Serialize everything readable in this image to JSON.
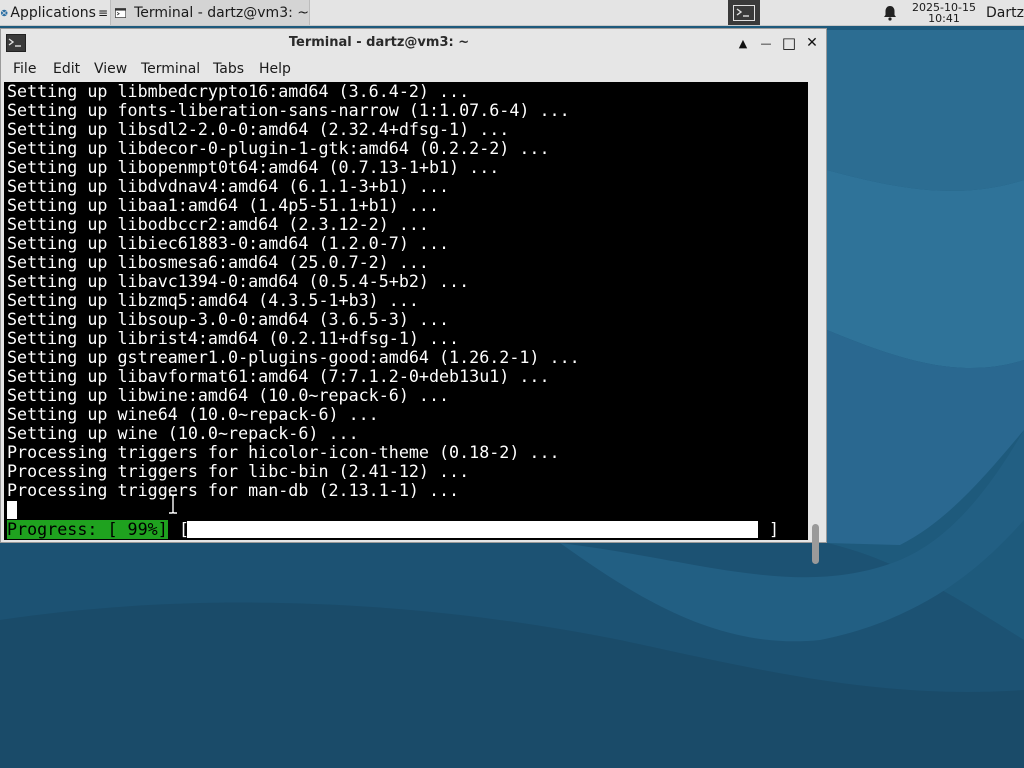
{
  "panel": {
    "apps_label": "Applications",
    "apps_icon": "xfce-mouse-icon",
    "task_label": "Terminal - dartz@vm3: ~",
    "task_icon": "terminal-icon",
    "workspace_icon": "terminal-icon",
    "notification_icon": "bell-icon",
    "date": "2025-10-15",
    "time": "10:41",
    "user": "Dartz"
  },
  "window": {
    "title": "Terminal - dartz@vm3: ~",
    "icon": "terminal-icon",
    "controls": {
      "shade": "▲",
      "minimize": "—",
      "maximize": "□",
      "close": "✕"
    }
  },
  "menubar": {
    "file": "File",
    "edit": "Edit",
    "view": "View",
    "terminal": "Terminal",
    "tabs": "Tabs",
    "help": "Help"
  },
  "terminal": {
    "lines": [
      "Setting up libmbedcrypto16:amd64 (3.6.4-2) ...",
      "Setting up fonts-liberation-sans-narrow (1:1.07.6-4) ...",
      "Setting up libsdl2-2.0-0:amd64 (2.32.4+dfsg-1) ...",
      "Setting up libdecor-0-plugin-1-gtk:amd64 (0.2.2-2) ...",
      "Setting up libopenmpt0t64:amd64 (0.7.13-1+b1) ...",
      "Setting up libdvdnav4:amd64 (6.1.1-3+b1) ...",
      "Setting up libaa1:amd64 (1.4p5-51.1+b1) ...",
      "Setting up libodbccr2:amd64 (2.3.12-2) ...",
      "Setting up libiec61883-0:amd64 (1.2.0-7) ...",
      "Setting up libosmesa6:amd64 (25.0.7-2) ...",
      "Setting up libavc1394-0:amd64 (0.5.4-5+b2) ...",
      "Setting up libzmq5:amd64 (4.3.5-1+b3) ...",
      "Setting up libsoup-3.0-0:amd64 (3.6.5-3) ...",
      "Setting up librist4:amd64 (0.2.11+dfsg-1) ...",
      "Setting up gstreamer1.0-plugins-good:amd64 (1.26.2-1) ...",
      "Setting up libavformat61:amd64 (7:7.1.2-0+deb13u1) ...",
      "Setting up libwine:amd64 (10.0~repack-6) ...",
      "Setting up wine64 (10.0~repack-6) ...",
      "Setting up wine (10.0~repack-6) ...",
      "Processing triggers for hicolor-icon-theme (0.18-2) ...",
      "Processing triggers for libc-bin (2.41-12) ...",
      "Processing triggers for man-db (2.13.1-1) ..."
    ],
    "progress_label": "Progress: [ 99%]",
    "progress_open": "[",
    "progress_close": "]",
    "progress_fraction": 0.99
  },
  "colors": {
    "terminal_bg": "#000000",
    "terminal_fg": "#ffffff",
    "progress_label_bg": "#1fa21f",
    "panel_bg": "#e4e4e4",
    "window_bg": "#e6e6e6",
    "desktop_bg": "#1f5778"
  }
}
